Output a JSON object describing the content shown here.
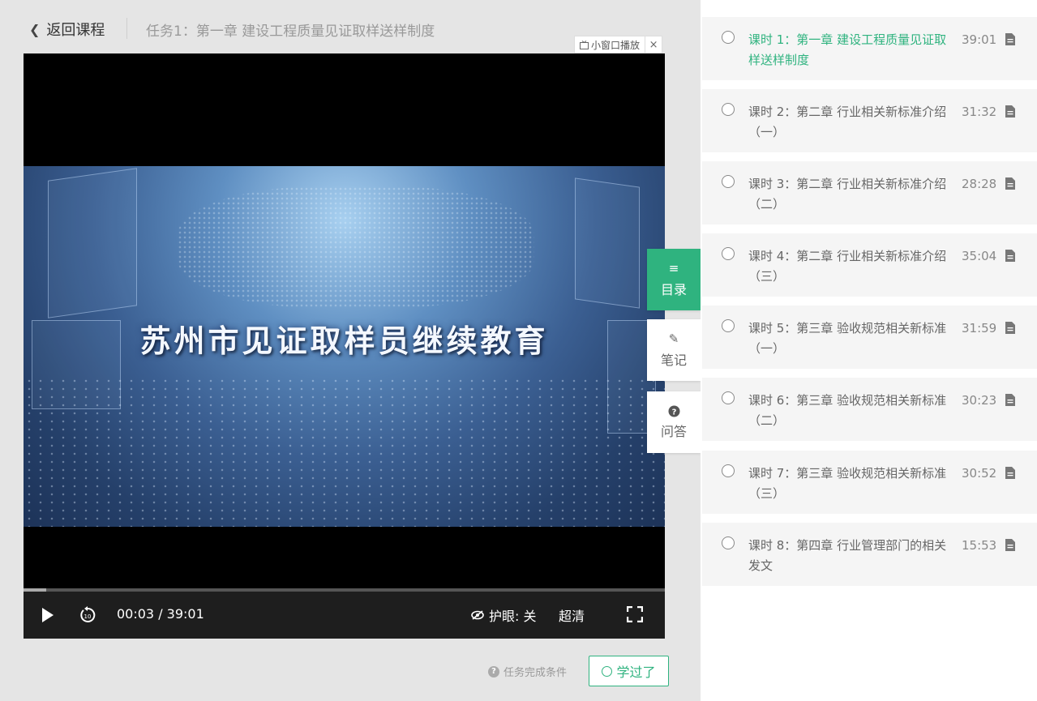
{
  "header": {
    "back_label": "返回课程",
    "task_title": "任务1：第一章 建设工程质量见证取样送样制度",
    "mini_player_label": "小窗口播放",
    "mini_player_close": "×"
  },
  "video": {
    "title_text": "苏州市见证取样员继续教育",
    "progress_fraction": 0.0013,
    "time_display": "00:03 / 39:01",
    "eye_label": "护眼: 关",
    "quality_label": "超清"
  },
  "side_tabs": [
    {
      "label": "目录",
      "icon": "list-icon"
    },
    {
      "label": "笔记",
      "icon": "pencil-icon"
    },
    {
      "label": "问答",
      "icon": "question-icon"
    }
  ],
  "bottom": {
    "complete_condition_label": "任务完成条件",
    "learned_button_label": "学过了"
  },
  "colors": {
    "accent": "#2fb37f",
    "panel_bg": "#f5f5f5",
    "page_bg": "#e5e5e5"
  },
  "lessons": [
    {
      "name": "课时 1：第一章 建设工程质量见证取样送样制度",
      "duration": "39:01",
      "active": true
    },
    {
      "name": "课时 2：第二章 行业相关新标准介绍（一）",
      "duration": "31:32",
      "active": false
    },
    {
      "name": "课时 3：第二章 行业相关新标准介绍（二）",
      "duration": "28:28",
      "active": false
    },
    {
      "name": "课时 4：第二章 行业相关新标准介绍（三）",
      "duration": "35:04",
      "active": false
    },
    {
      "name": "课时 5：第三章 验收规范相关新标准（一）",
      "duration": "31:59",
      "active": false
    },
    {
      "name": "课时 6：第三章 验收规范相关新标准（二）",
      "duration": "30:23",
      "active": false
    },
    {
      "name": "课时 7：第三章 验收规范相关新标准（三）",
      "duration": "30:52",
      "active": false
    },
    {
      "name": "课时 8：第四章 行业管理部门的相关发文",
      "duration": "15:53",
      "active": false
    }
  ]
}
